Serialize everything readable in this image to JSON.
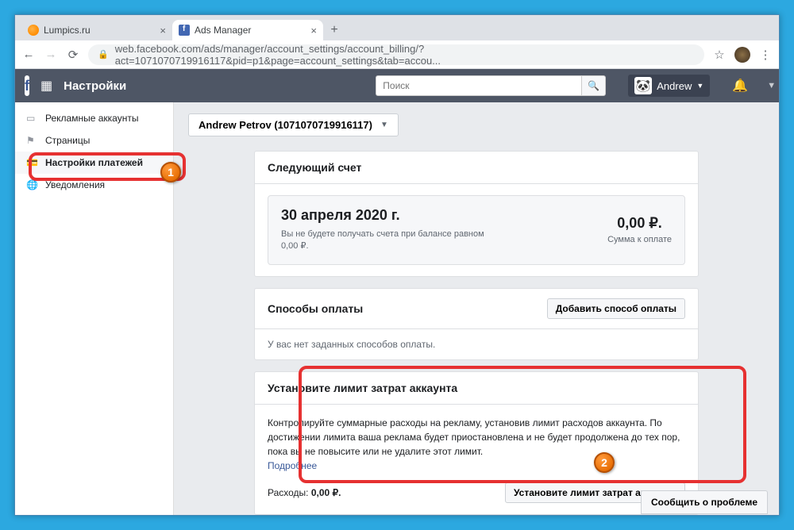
{
  "browser": {
    "tabs": [
      {
        "label": "Lumpics.ru",
        "active": false
      },
      {
        "label": "Ads Manager",
        "active": true
      }
    ],
    "url": "web.facebook.com/ads/manager/account_settings/account_billing/?act=1071070719916117&pid=p1&page=account_settings&tab=accou..."
  },
  "header": {
    "title": "Настройки",
    "search_placeholder": "Поиск",
    "user_name": "Andrew"
  },
  "sidebar": {
    "items": [
      {
        "label": "Рекламные аккаунты"
      },
      {
        "label": "Страницы"
      },
      {
        "label": "Настройки платежей"
      },
      {
        "label": "Уведомления"
      }
    ]
  },
  "account_selector": "Andrew Petrov (1071070719916117)",
  "next_bill": {
    "title": "Следующий счет",
    "date": "30 апреля 2020 г.",
    "note": "Вы не будете получать счета при балансе равном 0,00 ₽.",
    "amount": "0,00 ₽.",
    "amount_label": "Сумма к оплате"
  },
  "payment_methods": {
    "title": "Способы оплаты",
    "add_button": "Добавить способ оплаты",
    "empty": "У вас нет заданных способов оплаты."
  },
  "spend_limit": {
    "title": "Установите лимит затрат аккаунта",
    "description": "Контролируйте суммарные расходы на рекламу, установив лимит расходов аккаунта. По достижении лимита ваша реклама будет приостановлена и не будет продолжена до тех пор, пока вы не повысите или не удалите этот лимит.",
    "more_link": "Подробнее",
    "spend_label": "Расходы:",
    "spend_value": "0,00 ₽.",
    "button": "Установите лимит затрат аккаунта"
  },
  "footer_button": "Сообщить о проблеме",
  "annotations": {
    "n1": "1",
    "n2": "2"
  }
}
